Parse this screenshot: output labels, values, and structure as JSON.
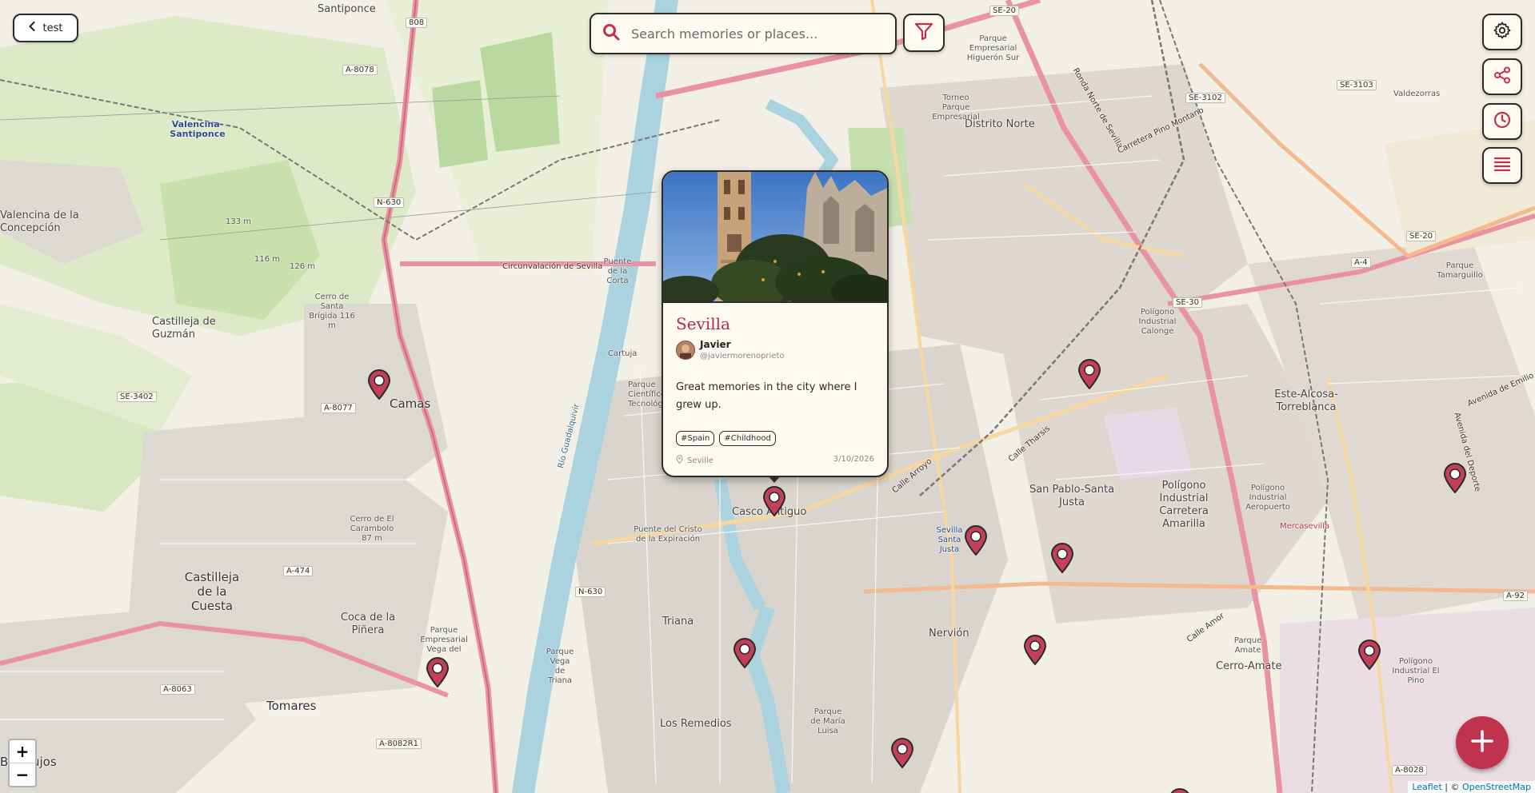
{
  "top_bar": {
    "back_label": "test",
    "search_placeholder": "Search memories or places..."
  },
  "icons": {
    "back": "chevron-left-icon",
    "search": "search-icon",
    "filter": "filter-icon",
    "settings": "gear-icon",
    "share": "share-icon",
    "history": "clock-icon",
    "layers": "list-icon",
    "add": "plus-icon",
    "marker": "map-pin-icon",
    "location": "location-pin-icon"
  },
  "colors": {
    "accent": "#c0334d",
    "marker": "#c2405a",
    "title": "#b32a44",
    "border": "#2b2b2b",
    "panel": "#fdfaf2"
  },
  "zoom": {
    "in": "+",
    "out": "−"
  },
  "attribution": {
    "leaflet": "Leaflet",
    "sep": " | © ",
    "osm": "OpenStreetMap"
  },
  "popup": {
    "title": "Sevilla",
    "author_name": "Javier",
    "author_handle": "@javiermorenoprieto",
    "text": "Great memories in the city where I grew up.",
    "tags": [
      "#Spain",
      "#Childhood"
    ],
    "place": "Seville",
    "date": "3/10/2026"
  },
  "map": {
    "labels": [
      "Santiponce",
      "Valencina-Santiponce",
      "Valencina de la Concepción",
      "Castilleja de Guzmán",
      "Camas",
      "Castilleja de la Cuesta",
      "Coca de la Piñera",
      "Tomares",
      "Bormujos",
      "Cerro de Santa Brígida 116 m",
      "Cerro de El Carambolo 87 m",
      "Parque Empresarial Vega del",
      "Puente de la Corta",
      "Cartuja",
      "Parque Científico y Tecnológico",
      "Río Guadalquivir",
      "Casco Antiguo",
      "Puente del Cristo de la Expiración",
      "Triana",
      "Los Remedios",
      "Parque Vega de Triana",
      "Parque de María Luisa",
      "Nervión",
      "Sevilla Santa Justa",
      "San Pablo-Santa Justa",
      "Distrito Norte",
      "Polígono Industrial Calonge",
      "Polígono Industrial Carretera Amarilla",
      "Polígono Industrial Aeropuerto",
      "Este-Alcosa-Torreblanca",
      "Cerro-Amate",
      "Parque Amate",
      "Polígono Industrial El Pino",
      "Parque Tamarguillo",
      "Valdezorras",
      "Torneo Parque Empresarial",
      "Parque Empresarial Higuerón Sur",
      "Circunvalación de Sevilla",
      "Ronda Norte de Sevilla",
      "Carretera Pino Montano",
      "Mercasevilla",
      "Avenida del Deporte",
      "Avenida de Emilio Lemos",
      "Calle Tharsis",
      "Calle Arroyo",
      "Calle Amor",
      "133 m",
      "126 m",
      "116 m"
    ],
    "road_shields": [
      "A-8078",
      "N-630",
      "SE-3402",
      "A-8077",
      "A-474",
      "A-8063",
      "A-8082R1",
      "N-630",
      "SE-20",
      "SE-3102",
      "SE-3103",
      "SE-20",
      "A-4",
      "SE-30",
      "A-92",
      "A-8028",
      "808"
    ]
  }
}
